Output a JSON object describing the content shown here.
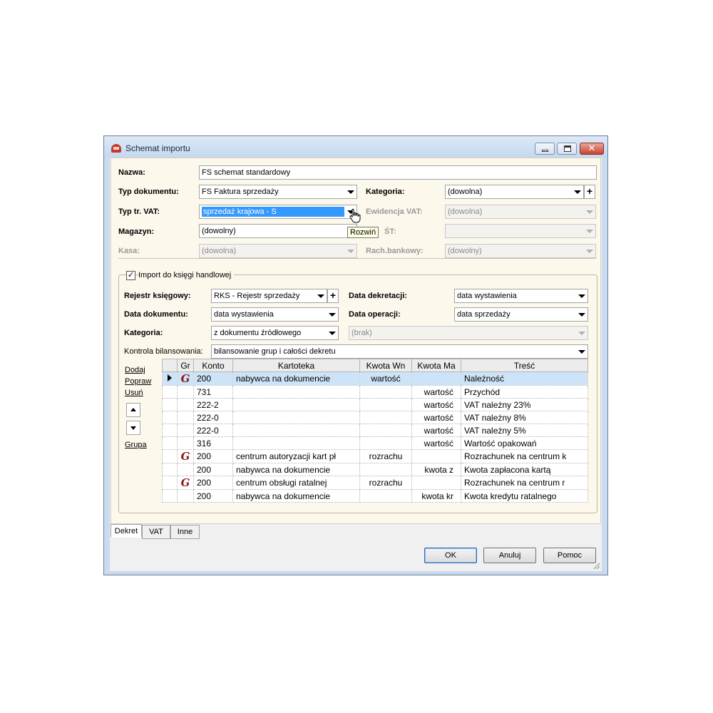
{
  "window": {
    "title": "Schemat importu",
    "close_glyph": "✕",
    "icon": "app-logo-icon"
  },
  "form": {
    "nazwa": {
      "label": "Nazwa:",
      "value": "FS schemat standardowy"
    },
    "typ_dokumentu": {
      "label": "Typ dokumentu:",
      "value": "FS Faktura sprzedaży"
    },
    "kategoria": {
      "label": "Kategoria:",
      "value": "(dowolna)",
      "add": "+"
    },
    "typ_tr_vat": {
      "label": "Typ tr. VAT:",
      "value": "sprzedaż krajowa - S"
    },
    "ewidencja_vat": {
      "label": "Ewidencja VAT:",
      "value": "(dowolna)"
    },
    "magazyn": {
      "label": "Magazyn:",
      "value": "(dowolny)"
    },
    "obscured_label": "ŚT:",
    "kasa": {
      "label": "Kasa:",
      "value": "(dowolna)"
    },
    "rach_bankowy": {
      "label": "Rach.bankowy:",
      "value": "(dowolny)"
    },
    "tooltip": "Rozwiń"
  },
  "import_group": {
    "checkbox_label": "Import do księgi handlowej",
    "checked": true,
    "check_glyph": "✓",
    "rejestr": {
      "label": "Rejestr księgowy:",
      "value": "RKS - Rejestr sprzedaży",
      "add": "+"
    },
    "data_dekretacji": {
      "label": "Data dekretacji:",
      "value": "data wystawienia"
    },
    "data_dokumentu": {
      "label": "Data dokumentu:",
      "value": "data wystawienia"
    },
    "data_operacji": {
      "label": "Data operacji:",
      "value": "data sprzedaży"
    },
    "kategoria": {
      "label": "Kategoria:",
      "value": "z dokumentu źródłowego",
      "value2": "(brak)"
    },
    "kontrola": {
      "label": "Kontrola bilansowania:",
      "value": "bilansowanie grup i całości dekretu"
    },
    "actions": {
      "dodaj": "Dodaj",
      "popraw": "Popraw",
      "usun": "Usuń",
      "grupa": "Grupa"
    },
    "grid": {
      "headers": [
        "",
        "Gr",
        "Konto",
        "Kartoteka",
        "Kwota Wn",
        "Kwota Ma",
        "Treść"
      ],
      "rows": [
        {
          "selected": true,
          "group": "G",
          "konto": "200",
          "kartoteka": "nabywca na dokumencie",
          "wn": "wartość",
          "ma": "",
          "tresc": "Należność"
        },
        {
          "selected": false,
          "group": "",
          "konto": "731",
          "kartoteka": "",
          "wn": "",
          "ma": "wartość",
          "tresc": "Przychód"
        },
        {
          "selected": false,
          "group": "",
          "konto": "222-2",
          "kartoteka": "",
          "wn": "",
          "ma": "wartość",
          "tresc": "VAT należny 23%"
        },
        {
          "selected": false,
          "group": "",
          "konto": "222-0",
          "kartoteka": "",
          "wn": "",
          "ma": "wartość",
          "tresc": "VAT należny 8%"
        },
        {
          "selected": false,
          "group": "",
          "konto": "222-0",
          "kartoteka": "",
          "wn": "",
          "ma": "wartość",
          "tresc": "VAT należny 5%"
        },
        {
          "selected": false,
          "group": "",
          "konto": "316",
          "kartoteka": "",
          "wn": "",
          "ma": "wartość",
          "tresc": "Wartość opakowań"
        },
        {
          "selected": false,
          "group": "G",
          "konto": "200",
          "kartoteka": "centrum autoryzacji kart pł",
          "wn": "rozrachu",
          "ma": "",
          "tresc": "Rozrachunek na centrum k"
        },
        {
          "selected": false,
          "group": "",
          "konto": "200",
          "kartoteka": "nabywca na dokumencie",
          "wn": "",
          "ma": "kwota z",
          "tresc": "Kwota zapłacona kartą"
        },
        {
          "selected": false,
          "group": "G",
          "konto": "200",
          "kartoteka": "centrum obsługi ratalnej",
          "wn": "rozrachu",
          "ma": "",
          "tresc": "Rozrachunek na centrum r"
        },
        {
          "selected": false,
          "group": "",
          "konto": "200",
          "kartoteka": "nabywca na dokumencie",
          "wn": "",
          "ma": "kwota kr",
          "tresc": "Kwota kredytu ratalnego"
        }
      ]
    }
  },
  "tabs": [
    "Dekret",
    "VAT",
    "Inne"
  ],
  "buttons": {
    "ok": "OK",
    "anuluj": "Anuluj",
    "pomoc": "Pomoc"
  }
}
